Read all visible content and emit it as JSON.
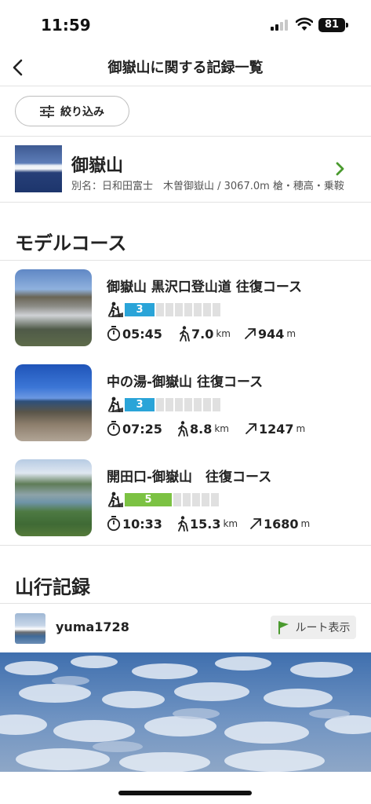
{
  "status": {
    "time": "11:59",
    "battery": "81"
  },
  "nav": {
    "title": "御嶽山に関する記録一覧"
  },
  "filter": {
    "label": "絞り込み"
  },
  "mountain": {
    "name": "御嶽山",
    "aliases": "別名：日和田富士　木曽御嶽山 / 3067.0m 槍・穂高・乗鞍"
  },
  "sections": {
    "model_course": "モデルコース",
    "records": "山行記録"
  },
  "courses": [
    {
      "title": "御嶽山 黒沢口登山道 往復コース",
      "level": "3",
      "level_color": "#2aa4d8",
      "time": "05:45",
      "distance": "7.0",
      "distance_unit": "km",
      "ascent": "944",
      "ascent_unit": "m"
    },
    {
      "title": "中の湯-御嶽山 往復コース",
      "level": "3",
      "level_color": "#2aa4d8",
      "time": "07:25",
      "distance": "8.8",
      "distance_unit": "km",
      "ascent": "1247",
      "ascent_unit": "m"
    },
    {
      "title": "開田口-御嶽山　往復コース",
      "level": "5",
      "level_color": "#7cc243",
      "time": "10:33",
      "distance": "15.3",
      "distance_unit": "km",
      "ascent": "1680",
      "ascent_unit": "m"
    }
  ],
  "record": {
    "user": "yuma1728",
    "route_label": "ルート表示"
  },
  "colors": {
    "accent_green": "#4a9a2e",
    "level_blue": "#2aa4d8",
    "level_green": "#7cc243"
  },
  "icons": [
    "back-chevron-icon",
    "filter-sliders-icon",
    "chevron-right-icon",
    "hiker-icon",
    "timer-icon",
    "walker-icon",
    "ascent-arrow-icon",
    "flag-icon"
  ]
}
